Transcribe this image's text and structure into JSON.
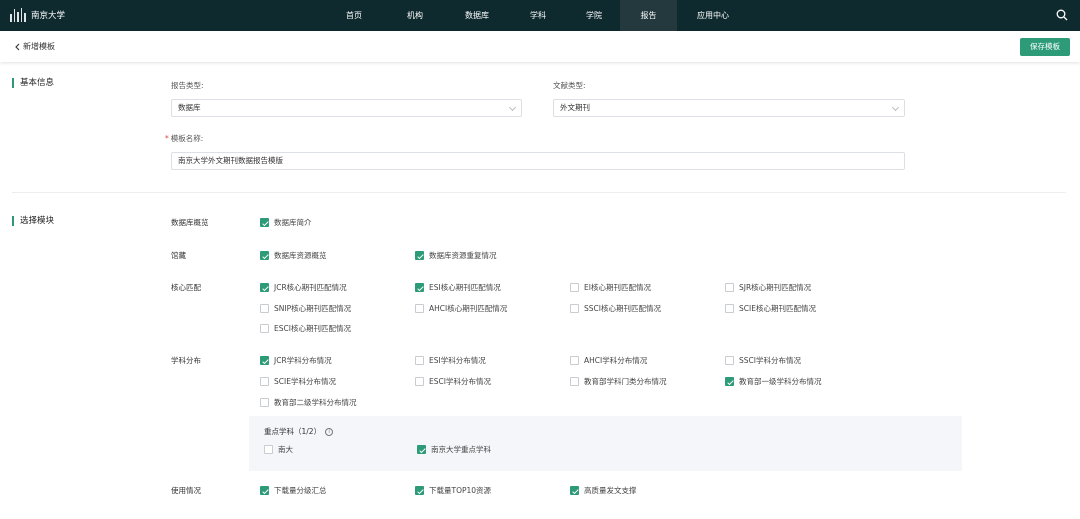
{
  "topnav": {
    "logo_text": "南京大学",
    "items": [
      {
        "label": "首页"
      },
      {
        "label": "机构"
      },
      {
        "label": "数据库"
      },
      {
        "label": "学科"
      },
      {
        "label": "学院"
      },
      {
        "label": "报告"
      },
      {
        "label": "应用中心"
      }
    ],
    "active_index": 5
  },
  "subheader": {
    "back_label": "新增模板",
    "save_label": "保存模板"
  },
  "basic": {
    "section_title": "基本信息",
    "report_type_label": "报告类型:",
    "report_type_value": "数据库",
    "doc_type_label": "文献类型:",
    "doc_type_value": "外文期刊",
    "template_name_label": "模板名称:",
    "template_name_required": "*",
    "template_name_value": "南京大学外文期刊数据报告模版"
  },
  "modules": {
    "section_title": "选择模块",
    "rows": [
      {
        "title": "数据库概览",
        "items": [
          {
            "label": "数据库简介",
            "checked": true
          }
        ]
      },
      {
        "title": "馆藏",
        "items": [
          {
            "label": "数据库资源概览",
            "checked": true
          },
          {
            "label": "数据库资源重复情况",
            "checked": true
          }
        ]
      },
      {
        "title": "核心匹配",
        "items": [
          {
            "label": "JCR核心期刊匹配情况",
            "checked": true
          },
          {
            "label": "ESI核心期刊匹配情况",
            "checked": true
          },
          {
            "label": "EI核心期刊匹配情况",
            "checked": false
          },
          {
            "label": "SJR核心期刊匹配情况",
            "checked": false
          },
          {
            "label": "SNIP核心期刊匹配情况",
            "checked": false
          },
          {
            "label": "AHCI核心期刊匹配情况",
            "checked": false
          },
          {
            "label": "SSCI核心期刊匹配情况",
            "checked": false
          },
          {
            "label": "SCIE核心期刊匹配情况",
            "checked": false
          },
          {
            "label": "ESCI核心期刊匹配情况",
            "checked": false
          }
        ]
      },
      {
        "title": "学科分布",
        "items": [
          {
            "label": "JCR学科分布情况",
            "checked": true
          },
          {
            "label": "ESI学科分布情况",
            "checked": false
          },
          {
            "label": "AHCI学科分布情况",
            "checked": false
          },
          {
            "label": "SSCI学科分布情况",
            "checked": false
          },
          {
            "label": "SCIE学科分布情况",
            "checked": false
          },
          {
            "label": "ESCI学科分布情况",
            "checked": false
          },
          {
            "label": "教育部学科门类分布情况",
            "checked": false
          },
          {
            "label": "教育部一级学科分布情况",
            "checked": true
          },
          {
            "label": "教育部二级学科分布情况",
            "checked": false
          }
        ]
      },
      {
        "title": "使用情况",
        "items": [
          {
            "label": "下载量分级汇总",
            "checked": true
          },
          {
            "label": "下载量TOP10资源",
            "checked": true
          },
          {
            "label": "高质量发文支撑",
            "checked": true
          }
        ]
      }
    ],
    "key_subjects": {
      "title": "重点学科（1/2）",
      "info_glyph": "i",
      "items": [
        {
          "label": "南大",
          "checked": false
        },
        {
          "label": "南京大学重点学科",
          "checked": true
        }
      ]
    }
  },
  "colors": {
    "accent": "#2d9b78",
    "nav_bg": "#0f2a2f"
  }
}
